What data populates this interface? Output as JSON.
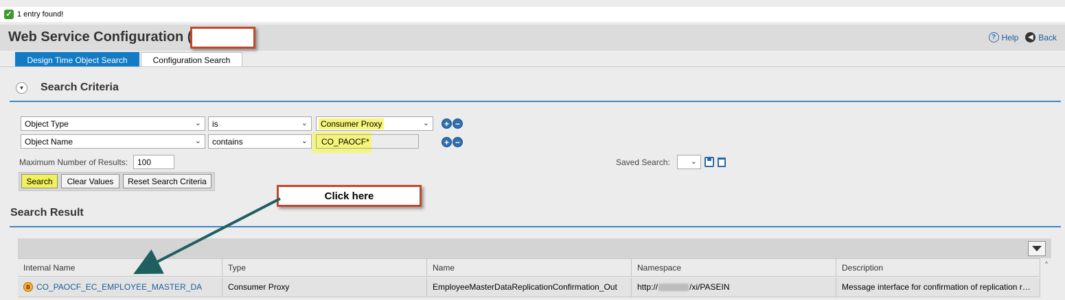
{
  "message": {
    "text": "1 entry found!"
  },
  "header": {
    "title": "Web Service Configuration (",
    "help": "Help",
    "back": "Back"
  },
  "tabs": [
    {
      "label": "Design Time Object Search",
      "active": true
    },
    {
      "label": "Configuration Search",
      "active": false
    }
  ],
  "criteria": {
    "title": "Search Criteria",
    "rows": [
      {
        "field": "Object Type",
        "operator": "is",
        "value": "Consumer Proxy"
      },
      {
        "field": "Object Name",
        "operator": "contains",
        "value": "CO_PAOCF*"
      }
    ],
    "max_results_label": "Maximum Number of Results:",
    "max_results_value": "100",
    "saved_search_label": "Saved Search:",
    "buttons": {
      "search": "Search",
      "clear": "Clear Values",
      "reset": "Reset Search Criteria"
    }
  },
  "callout": {
    "text": "Click here"
  },
  "results": {
    "title": "Search Result",
    "columns": [
      "Internal Name",
      "Type",
      "Name",
      "Namespace",
      "Description"
    ],
    "rows": [
      {
        "internal_name": "CO_PAOCF_EC_EMPLOYEE_MASTER_DA",
        "type": "Consumer Proxy",
        "name": "EmployeeMasterDataReplicationConfirmation_Out",
        "namespace_prefix": "http://",
        "namespace_suffix": "/xi/PASEIN",
        "description": "Message interface for confirmation of replication r…"
      }
    ]
  },
  "colors": {
    "accent": "#127bc4",
    "highlight": "#f5f57a",
    "callout_border": "#c0472a",
    "arrow": "#1f5f5f"
  }
}
